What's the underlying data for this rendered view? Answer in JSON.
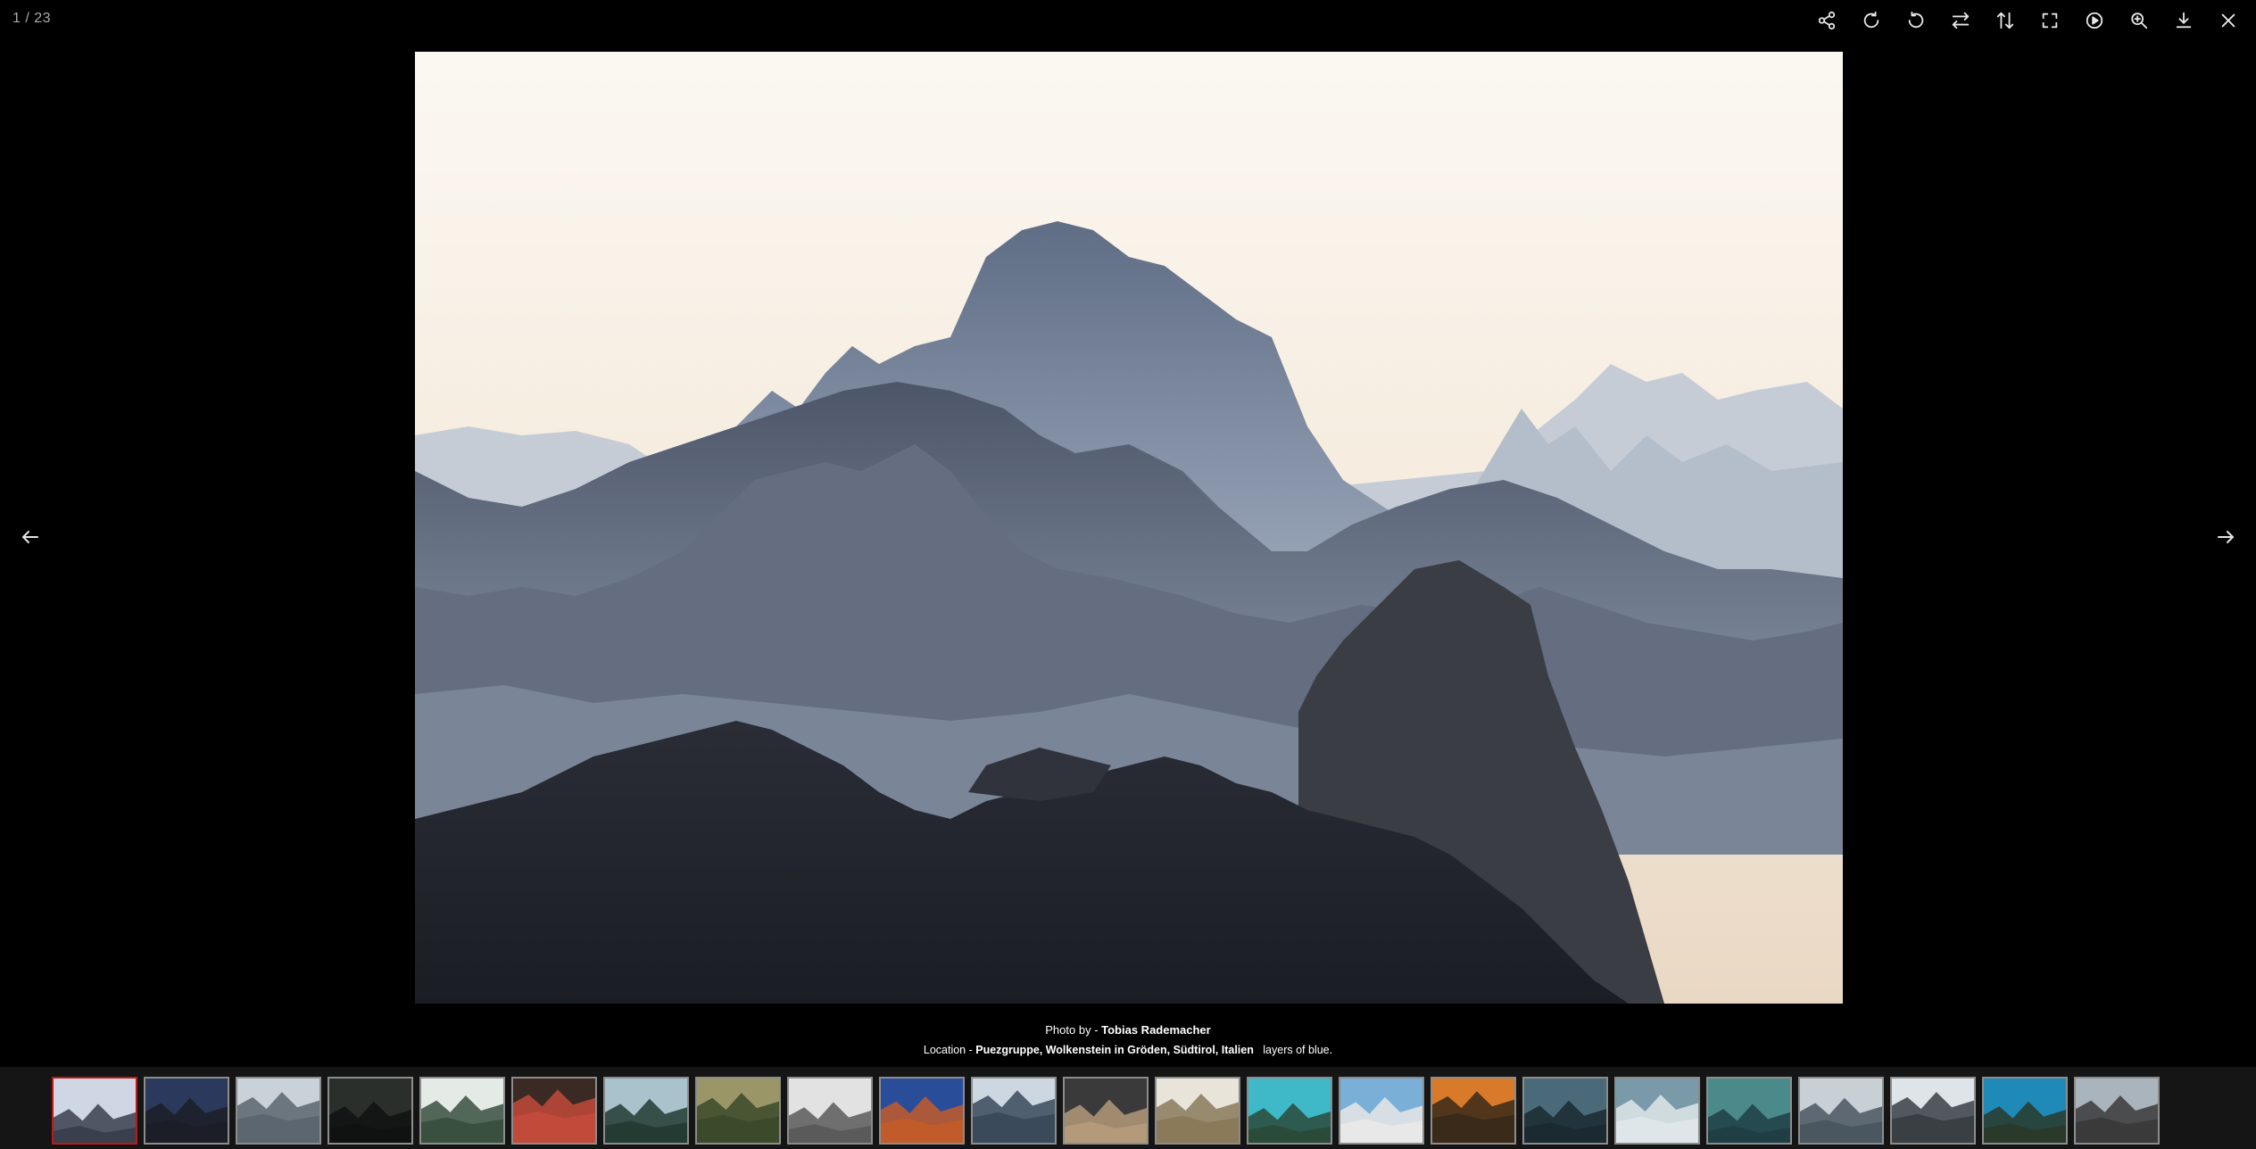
{
  "viewer": {
    "counter": "1 / 23",
    "toolbar": [
      {
        "name": "share-icon"
      },
      {
        "name": "rotate-right-icon"
      },
      {
        "name": "rotate-left-icon"
      },
      {
        "name": "flip-horizontal-icon"
      },
      {
        "name": "flip-vertical-icon"
      },
      {
        "name": "fullscreen-icon"
      },
      {
        "name": "play-slideshow-icon"
      },
      {
        "name": "zoom-in-icon"
      },
      {
        "name": "download-icon"
      },
      {
        "name": "close-icon"
      }
    ],
    "nav": {
      "prev_icon": "arrow-left-icon",
      "next_icon": "arrow-right-icon"
    }
  },
  "caption": {
    "photo_prefix": "Photo by - ",
    "photographer": "Tobias Rademacher",
    "location_prefix": "Location - ",
    "location": "Puezgruppe, Wolkenstein in Gröden, Südtirol, Italien",
    "description": "layers of blue."
  },
  "thumbnails": {
    "active_index": 0,
    "colors": [
      [
        "#cfd6e4",
        "#3a3f4e"
      ],
      [
        "#2b3a5c",
        "#1b1e26"
      ],
      [
        "#c9d2d8",
        "#5b6670"
      ],
      [
        "#2a2f2b",
        "#0f1210"
      ],
      [
        "#e4ebe6",
        "#39503f"
      ],
      [
        "#3b2a24",
        "#c24a3a"
      ],
      [
        "#a9c2cc",
        "#233b33"
      ],
      [
        "#9a9668",
        "#3c4a2c"
      ],
      [
        "#e2e2e2",
        "#5a5a5a"
      ],
      [
        "#2a4d9a",
        "#c25b2a"
      ],
      [
        "#cdd7e2",
        "#3a4a5a"
      ],
      [
        "#3a3a3a",
        "#b49a7a"
      ],
      [
        "#e8e4da",
        "#8a7a5a"
      ],
      [
        "#3fb8c8",
        "#2a4a3a"
      ],
      [
        "#7ab0d8",
        "#e8e8e8"
      ],
      [
        "#d87a2a",
        "#3a2a1a"
      ],
      [
        "#4a6a7a",
        "#1a2a30"
      ],
      [
        "#7a9aaa",
        "#dfe6ea"
      ],
      [
        "#4a8a8a",
        "#1f3f45"
      ],
      [
        "#c8d0d6",
        "#4a5660"
      ],
      [
        "#dfe4e8",
        "#3a3f44"
      ],
      [
        "#1f8ab8",
        "#2a3a2a"
      ],
      [
        "#aab4bc",
        "#3a3a3a"
      ]
    ]
  }
}
